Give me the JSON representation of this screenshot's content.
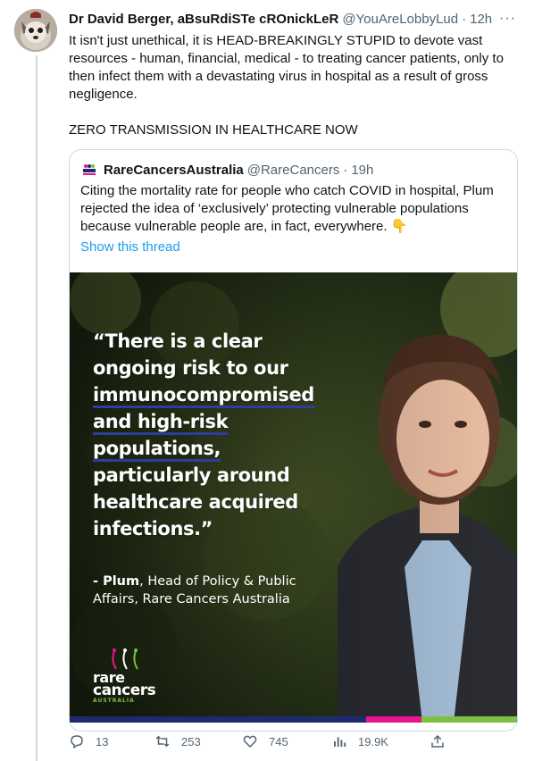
{
  "tweet": {
    "author_name": "Dr David Berger, aBsuRdiSTe cROnickLeR",
    "author_handle": "@YouAreLobbyLud",
    "separator": "·",
    "time": "12h",
    "more_label": "···",
    "text_paragraph_1": "It isn't just unethical, it is HEAD-BREAKINGLY STUPID to devote vast resources - human, financial, medical - to treating cancer patients, only to then infect them with a devastating virus in hospital as a result of gross negligence.",
    "text_paragraph_2": "ZERO TRANSMISSION IN HEALTHCARE NOW"
  },
  "quoted": {
    "author_name": "RareCancersAustralia",
    "author_handle": "@RareCancers",
    "separator": "·",
    "time": "19h",
    "text": "Citing the mortality rate for people who catch COVID in hospital, Plum rejected the idea of ‘exclusively’ protecting vulnerable populations because vulnerable people are, in fact, everywhere. 👇",
    "show_thread": "Show this thread",
    "image": {
      "quote_lines": [
        "“There is a clear",
        "ongoing risk to our",
        "immunocompromised",
        "and high-risk",
        "populations,",
        "particularly around",
        "healthcare acquired",
        "infections.”"
      ],
      "attribution_name": "- Plum",
      "attribution_rest": ", Head of Policy & Public Affairs, Rare Cancers Australia",
      "logo_word_1": "rare",
      "logo_word_2": "cancers",
      "logo_word_3": "AUSTRALIA",
      "bar_colors": [
        "#1e2a6e",
        "#e6168c",
        "#7bc142"
      ]
    }
  },
  "actions": {
    "replies": "13",
    "retweets": "253",
    "likes": "745",
    "views": "19.9K"
  },
  "colors": {
    "link_blue": "#1d9bf0",
    "secondary_text": "#536471",
    "border": "#cfd9de"
  }
}
